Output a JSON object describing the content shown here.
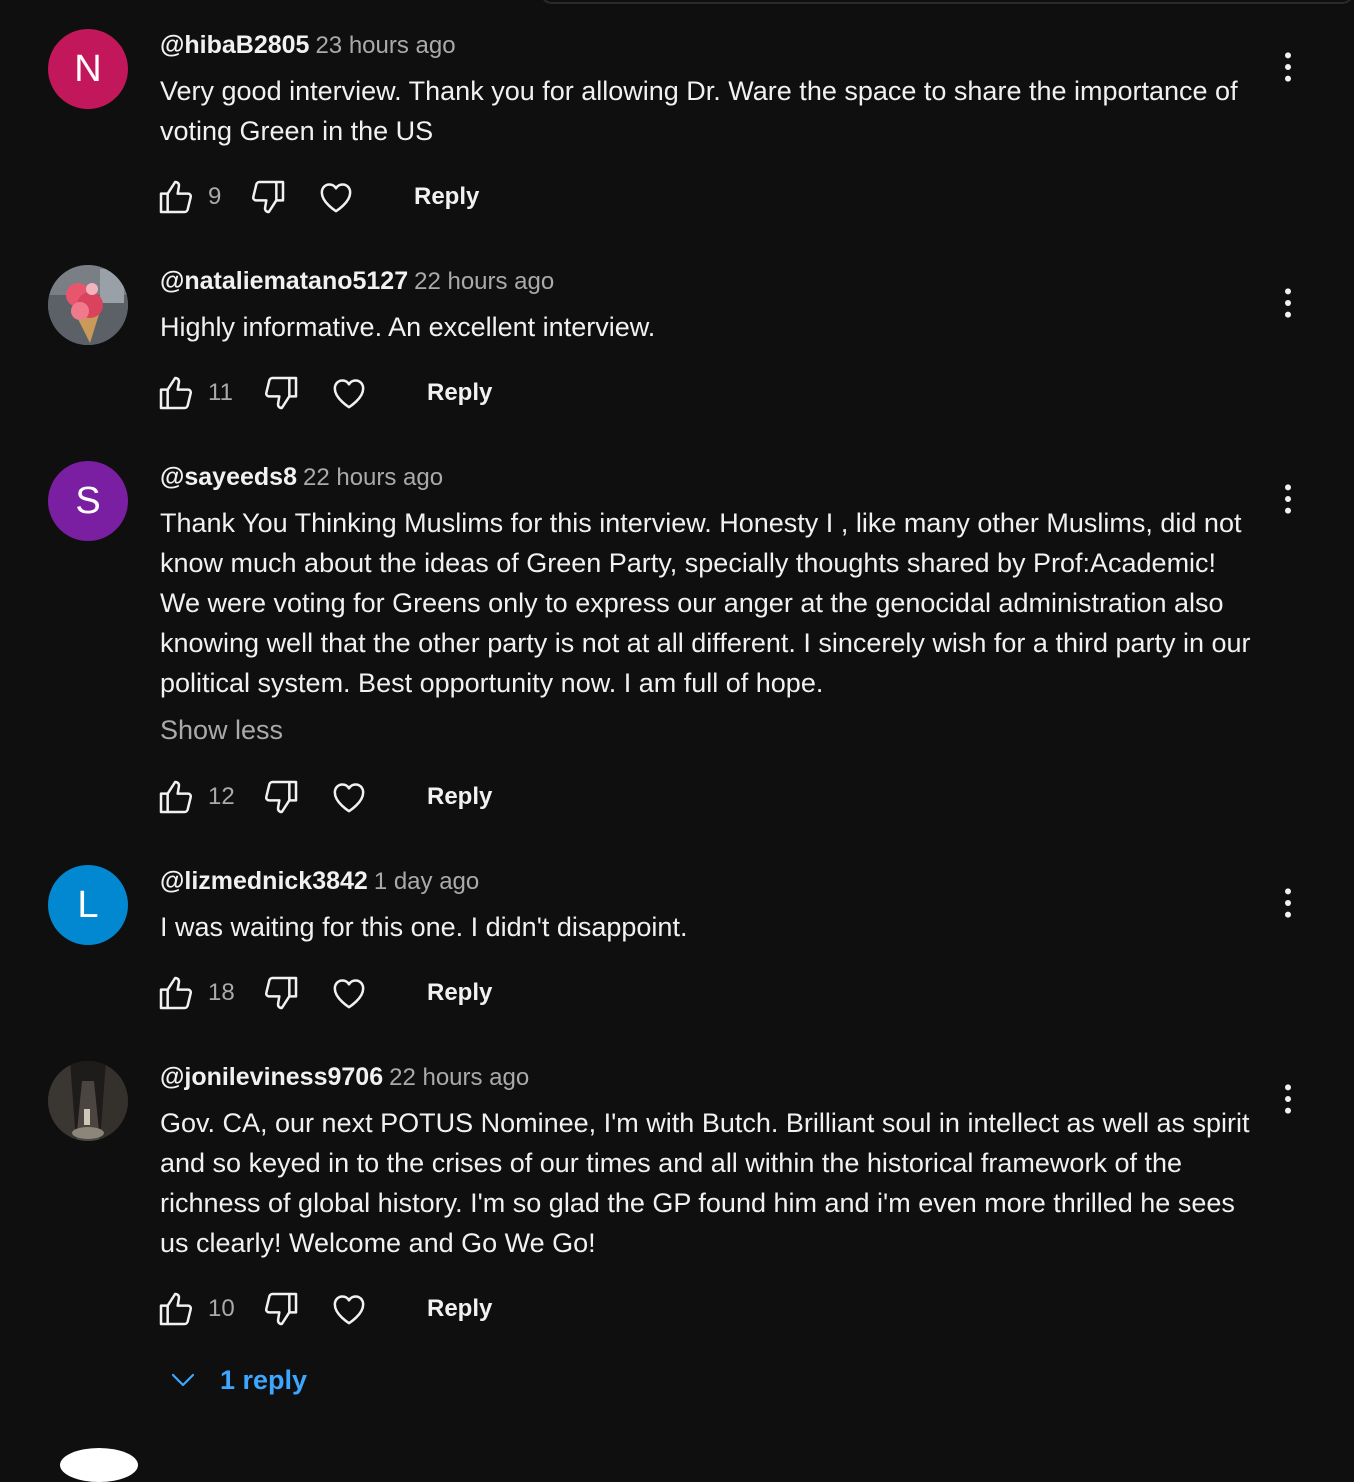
{
  "comments": [
    {
      "author": "@hibaB2805",
      "time": "23 hours ago",
      "text": "Very good interview. Thank you for allowing Dr. Ware the space to share the importance of voting Green in the US",
      "likes": "9",
      "reply_label": "Reply",
      "avatar_letter": "N",
      "avatar_color": "#c2185b"
    },
    {
      "author": "@nataliematano5127",
      "time": "22 hours ago",
      "text": "Highly informative. An excellent interview.",
      "likes": "11",
      "reply_label": "Reply",
      "avatar_letter": "",
      "avatar_color": "#6b6b6b"
    },
    {
      "author": "@sayeeds8",
      "time": "22 hours ago",
      "text": "Thank You Thinking Muslims for this interview. Honesty I , like many other Muslims, did not know much about the ideas of Green Party, specially thoughts shared by Prof:Academic!  We were voting for Greens only to express our anger at the genocidal administration also knowing well that the other party is not at all different. I sincerely wish for a third party in our political system. Best opportunity now. I am full of hope.",
      "show_less_label": "Show less",
      "likes": "12",
      "reply_label": "Reply",
      "avatar_letter": "S",
      "avatar_color": "#7b1fa2"
    },
    {
      "author": "@lizmednick3842",
      "time": "1 day ago",
      "text": "I was waiting for this one. I didn't disappoint.",
      "likes": "18",
      "reply_label": "Reply",
      "avatar_letter": "L",
      "avatar_color": "#0288d1"
    },
    {
      "author": "@jonileviness9706",
      "time": "22 hours ago",
      "text": "Gov. CA, our next POTUS Nominee, I'm with Butch. Brilliant soul in intellect as well as spirit and so keyed in to the crises of our times and all within the historical framework of the richness of global history. I'm so glad the GP found him and i'm even more thrilled he sees us clearly! Welcome and Go We Go!",
      "likes": "10",
      "reply_label": "Reply",
      "avatar_letter": "",
      "avatar_color": "#2b2b2b",
      "replies_label": "1 reply"
    }
  ],
  "colors": {
    "background": "#0f0f0f",
    "primary_text": "#f1f1f1",
    "secondary_text": "#aaaaaa",
    "link_blue": "#3ea6ff"
  },
  "icons": [
    "thumb-up-icon",
    "thumb-down-icon",
    "heart-icon",
    "more-vert-icon",
    "chevron-down-icon"
  ]
}
